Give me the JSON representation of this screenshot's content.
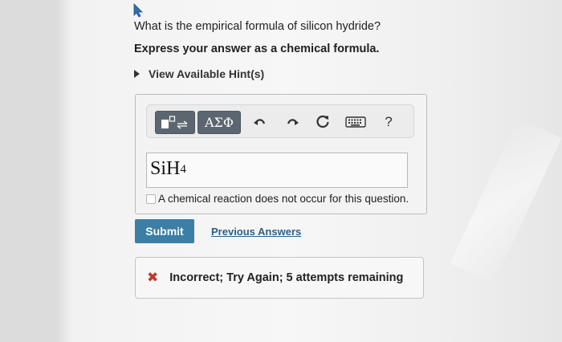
{
  "question": {
    "text": "What is the empirical formula of silicon hydride?",
    "instruction": "Express your answer as a chemical formula."
  },
  "hints": {
    "label": "View Available Hint(s)",
    "icon": "triangle-right-icon"
  },
  "toolbar": {
    "greek_label": "ΑΣΦ",
    "help_label": "?",
    "icons": [
      "template-icon",
      "undo-icon",
      "redo-icon",
      "reset-icon",
      "keyboard-icon"
    ]
  },
  "answer": {
    "formula_main": "SiH",
    "formula_sub": "4"
  },
  "no_reaction_label": "A chemical reaction does not occur for this question.",
  "submit_label": "Submit",
  "previous_answers_label": "Previous Answers",
  "feedback": {
    "icon_char": "✖",
    "text": "Incorrect; Try Again; 5 attempts remaining"
  },
  "colors": {
    "accent": "#3b7ea6",
    "error": "#c0392b",
    "toolbar_button": "#5c6670"
  }
}
